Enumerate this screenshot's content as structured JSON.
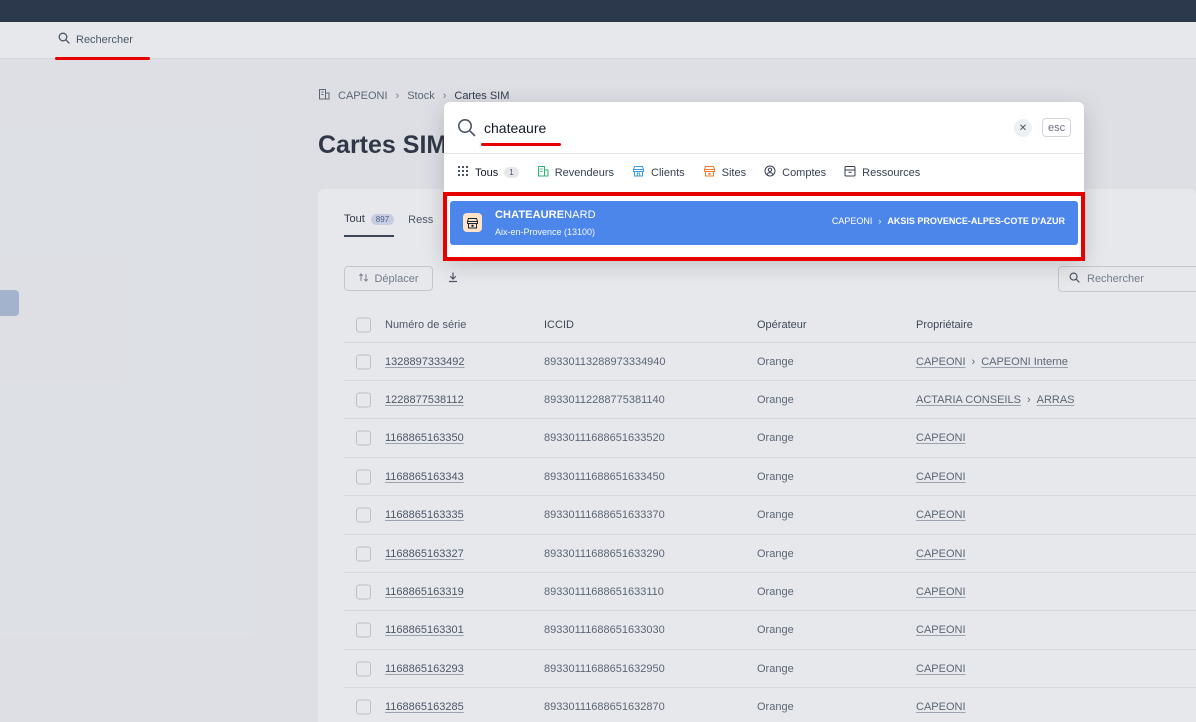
{
  "topbar": {
    "search_label": "Rechercher"
  },
  "breadcrumb": [
    "CAPEONI",
    "Stock",
    "Cartes SIM"
  ],
  "page": {
    "title": "Cartes SIM"
  },
  "tabs": [
    {
      "label": "Tout",
      "count": "897"
    },
    {
      "label": "Ress"
    }
  ],
  "toolbar": {
    "move_label": "Déplacer",
    "search_placeholder": "Rechercher"
  },
  "table": {
    "columns": [
      "Numéro de série",
      "ICCID",
      "Opérateur",
      "Propriétaire"
    ],
    "rows": [
      {
        "serial": "1328897333492",
        "iccid": "89330113288973334940",
        "operator": "Orange",
        "owner": [
          "CAPEONI",
          "CAPEONI Interne"
        ]
      },
      {
        "serial": "1228877538112",
        "iccid": "89330112288775381140",
        "operator": "Orange",
        "owner": [
          "ACTARIA CONSEILS",
          "ARRAS"
        ]
      },
      {
        "serial": "1168865163350",
        "iccid": "89330111688651633520",
        "operator": "Orange",
        "owner": [
          "CAPEONI"
        ]
      },
      {
        "serial": "1168865163343",
        "iccid": "89330111688651633450",
        "operator": "Orange",
        "owner": [
          "CAPEONI"
        ]
      },
      {
        "serial": "1168865163335",
        "iccid": "89330111688651633370",
        "operator": "Orange",
        "owner": [
          "CAPEONI"
        ]
      },
      {
        "serial": "1168865163327",
        "iccid": "89330111688651633290",
        "operator": "Orange",
        "owner": [
          "CAPEONI"
        ]
      },
      {
        "serial": "1168865163319",
        "iccid": "89330111688651633110",
        "operator": "Orange",
        "owner": [
          "CAPEONI"
        ]
      },
      {
        "serial": "1168865163301",
        "iccid": "89330111688651633030",
        "operator": "Orange",
        "owner": [
          "CAPEONI"
        ]
      },
      {
        "serial": "1168865163293",
        "iccid": "89330111688651632950",
        "operator": "Orange",
        "owner": [
          "CAPEONI"
        ]
      },
      {
        "serial": "1168865163285",
        "iccid": "89330111688651632870",
        "operator": "Orange",
        "owner": [
          "CAPEONI"
        ]
      }
    ]
  },
  "search_dialog": {
    "query": "chateaure",
    "esc_label": "esc",
    "filters": [
      {
        "label": "Tous",
        "count": "1",
        "icon": "grid-icon"
      },
      {
        "label": "Revendeurs",
        "icon": "building-icon"
      },
      {
        "label": "Clients",
        "icon": "store-icon"
      },
      {
        "label": "Sites",
        "icon": "site-icon"
      },
      {
        "label": "Comptes",
        "icon": "user-circle-icon"
      },
      {
        "label": "Ressources",
        "icon": "box-icon"
      }
    ],
    "result": {
      "name_match": "CHATEAURE",
      "name_rest": "NARD",
      "subtitle": "Aix-en-Provence (13100)",
      "path": [
        "CAPEONI",
        "AKSIS PROVENCE-ALPES-COTE D'AZUR"
      ]
    }
  },
  "colors": {
    "accent": "#4d86ea",
    "annotation": "#e60000",
    "topbar": "#0b1a2e"
  }
}
